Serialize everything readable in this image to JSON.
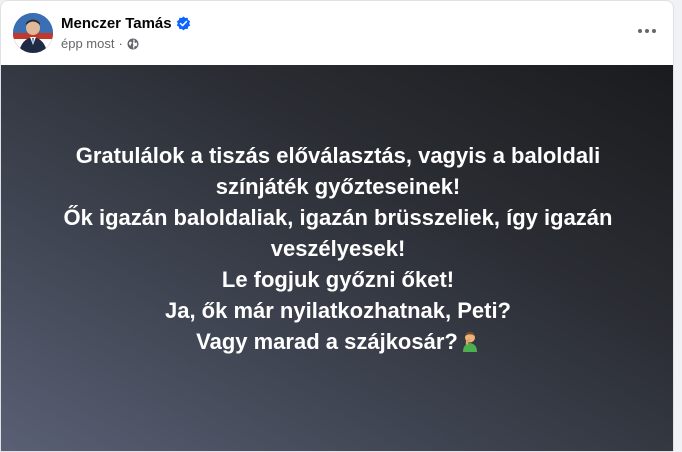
{
  "post": {
    "author": "Menczer Tamás",
    "timestamp": "épp most",
    "separator": "·",
    "privacy_icon": "globe-icon",
    "verified_icon": "verified-badge-icon",
    "more_icon": "more-options-icon",
    "text_lines": [
      "Gratulálok a tiszás előválasztás, vagyis a baloldali",
      "színjáték győzteseinek!",
      "Ők igazán baloldaliak, igazán brüsszeliek, így igazán",
      "veszélyesek!",
      "Le fogjuk győzni őket!",
      "Ja, ők már nyilatkozhatnak, Peti?",
      "Vagy marad a szájkosár?"
    ],
    "trailing_emoji": "person-facepalming-emoji"
  },
  "colors": {
    "verified_blue": "#0866ff",
    "meta_gray": "#65676b",
    "author_text": "#050505",
    "post_text": "#ffffff",
    "emoji_green": "#4caf50"
  }
}
